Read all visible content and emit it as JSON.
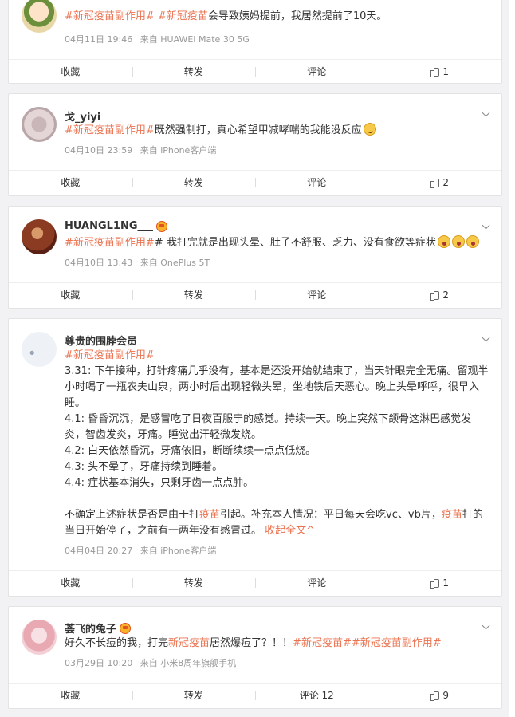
{
  "colors": {
    "topic": "#eb7350",
    "meta": "#999999",
    "background": "#f2f2f5"
  },
  "posts": [
    {
      "name": "",
      "content": [
        {
          "t": "topic",
          "v": "#新冠疫苗副作用#"
        },
        {
          "t": "text",
          "v": " "
        },
        {
          "t": "topic",
          "v": "#新冠疫苗"
        },
        {
          "t": "text",
          "v": "会导致姨妈提前，我居然提前了10天。"
        }
      ],
      "date": "04月11日 19:46",
      "source": "来自 HUAWEI Mate 30 5G",
      "actions": {
        "collect": "收藏",
        "repost": "转发",
        "comment": "评论",
        "like": "1"
      }
    },
    {
      "name": "戈_yiyi",
      "content": [
        {
          "t": "topic",
          "v": "#新冠疫苗副作用#"
        },
        {
          "t": "text",
          "v": "既然强制打，真心希望甲减哮喘的我能没反应"
        },
        {
          "t": "emoji",
          "v": "smile-emoji"
        }
      ],
      "date": "04月10日 23:59",
      "source": "来自 iPhone客户端",
      "actions": {
        "collect": "收藏",
        "repost": "转发",
        "comment": "评论",
        "like": "2"
      }
    },
    {
      "name": "HUANGL1NG___",
      "content": [
        {
          "t": "topic",
          "v": "#新冠疫苗副作用#"
        },
        {
          "t": "text",
          "v": "# 我打完就是出现头晕、肚子不舒服、乏力、没有食欲等症状"
        },
        {
          "t": "emoji",
          "v": "shocked-emoji"
        },
        {
          "t": "emoji",
          "v": "shocked-emoji"
        },
        {
          "t": "emoji",
          "v": "shocked-emoji"
        }
      ],
      "date": "04月10日 13:43",
      "source": "来自 OnePlus 5T",
      "actions": {
        "collect": "收藏",
        "repost": "转发",
        "comment": "评论",
        "like": "2"
      }
    },
    {
      "name": "尊贵的围脖会员",
      "topic_line": "#新冠疫苗副作用#",
      "paragraphs": [
        "3.31: 下午接种，打针疼痛几乎没有，基本是还没开始就结束了，当天针眼完全无痛。留观半小时喝了一瓶农夫山泉，两小时后出现轻微头晕，坐地铁后天恶心。晚上头晕呼呼，很早入睡。",
        "4.1: 昏昏沉沉，是感冒吃了日夜百服宁的感觉。持续一天。晚上突然下颌骨这淋巴感觉发炎，智齿发炎，牙痛。睡觉出汗轻微发烧。",
        "4.2: 白天依然昏沉，牙痛依旧，断断续续一点点低烧。",
        "4.3: 头不晕了，牙痛持续到睡着。",
        "4.4: 症状基本消失，只剩牙齿一点点肿。"
      ],
      "extra_a": "不确定上述症状是否是由于打",
      "extra_kw1": "疫苗",
      "extra_b": "引起。补充本人情况：平日每天会吃vc、vb片，",
      "extra_kw2": "疫苗",
      "extra_c": "打的当日开始停了，之前有一两年没有感冒过。",
      "collapse_label": "收起全文^",
      "date": "04月04日 20:27",
      "source": "来自 iPhone客户端",
      "actions": {
        "collect": "收藏",
        "repost": "转发",
        "comment": "评论",
        "like": "1"
      }
    },
    {
      "name": "荟飞的兔子",
      "c_a": "好久不长痘的我，打完",
      "c_kw": "新冠疫苗",
      "c_b": "居然爆痘了？！！",
      "c_t1": "#新冠疫苗#",
      "c_t2": "#新冠疫苗副作用#",
      "date": "03月29日 10:20",
      "source": "来自 小米8周年旗舰手机",
      "actions": {
        "collect": "收藏",
        "repost": "转发",
        "comment": "评论 12",
        "like": "9"
      }
    }
  ]
}
